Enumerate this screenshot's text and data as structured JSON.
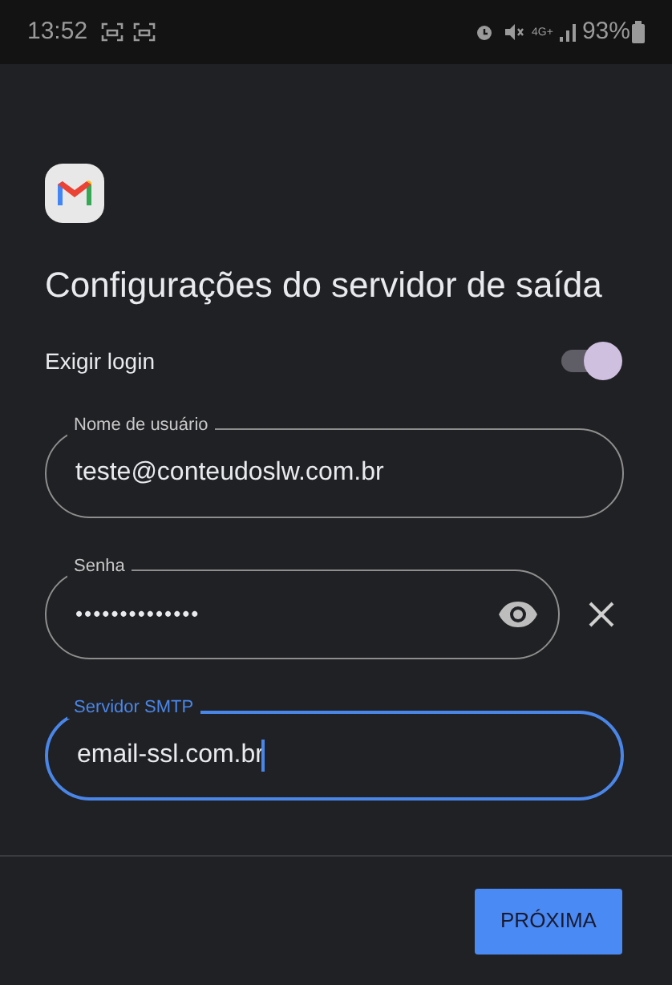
{
  "status_bar": {
    "time": "13:52",
    "network": "4G+",
    "battery": "93%"
  },
  "title": "Configurações do servidor de saída",
  "require_login": {
    "label": "Exigir login",
    "on": true
  },
  "fields": [
    {
      "label": "Nome de usuário",
      "value": "teste@conteudoslw.com.br",
      "focused": false,
      "kind": "text"
    },
    {
      "label": "Senha",
      "value": "••••••••••••••",
      "focused": false,
      "kind": "password"
    },
    {
      "label": "Servidor SMTP",
      "value": "email-ssl.com.br",
      "focused": true,
      "kind": "text"
    }
  ],
  "next_button": "PRÓXIMA"
}
